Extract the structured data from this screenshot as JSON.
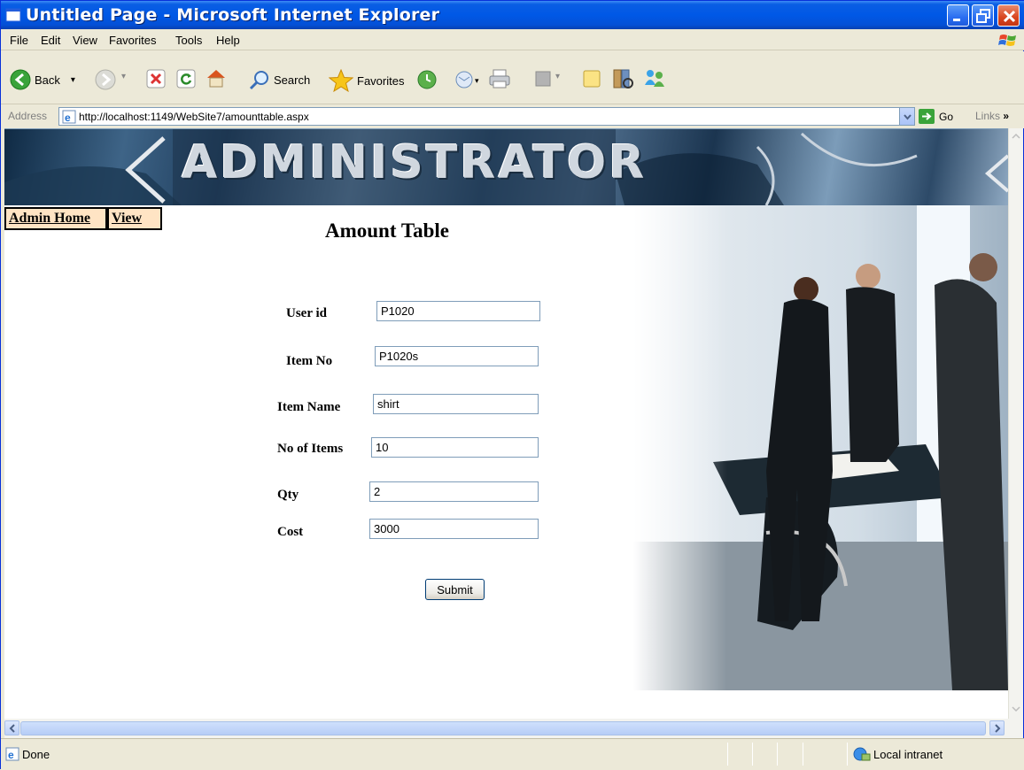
{
  "window": {
    "title": "Untitled Page - Microsoft Internet Explorer"
  },
  "menu": {
    "items": [
      "File",
      "Edit",
      "View",
      "Favorites",
      "Tools",
      "Help"
    ]
  },
  "toolbar": {
    "back_label": "Back",
    "search_label": "Search",
    "favorites_label": "Favorites"
  },
  "address": {
    "label": "Address",
    "url": "http://localhost:1149/WebSite7/amounttable.aspx",
    "go_label": "Go",
    "links_label": "Links"
  },
  "page": {
    "banner_text": "ADMINISTRATOR",
    "nav": {
      "admin_home": "Admin Home",
      "view": "View"
    },
    "title": "Amount Table",
    "form": {
      "fields": [
        {
          "label": "User id",
          "value": "P1020"
        },
        {
          "label": "Item No",
          "value": "P1020s"
        },
        {
          "label": "Item Name",
          "value": "shirt"
        },
        {
          "label": "No of Items",
          "value": "10"
        },
        {
          "label": "Qty",
          "value": "2"
        },
        {
          "label": "Cost",
          "value": "3000"
        }
      ],
      "submit_label": "Submit"
    }
  },
  "status": {
    "text": "Done",
    "zone": "Local intranet"
  },
  "colors": {
    "titlebar": "#0058e6",
    "nav_bg": "#ffe4c4",
    "input_border": "#7f9db9"
  }
}
